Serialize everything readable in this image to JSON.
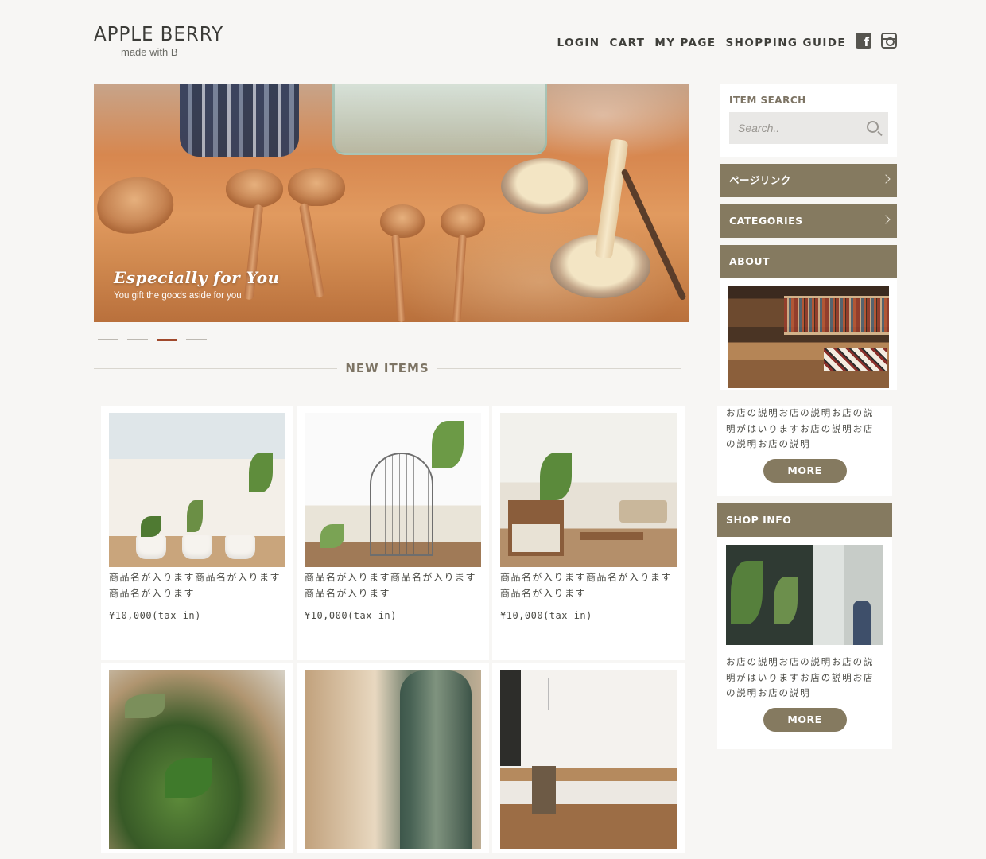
{
  "brand": {
    "name": "APPLE BERRY",
    "tagline": "made with B"
  },
  "nav": {
    "links": [
      "LOGIN",
      "CART",
      "MY PAGE",
      "SHOPPING GUIDE"
    ],
    "social": [
      "facebook-icon",
      "instagram-icon"
    ]
  },
  "hero": {
    "title": "Especially for You",
    "subtitle": "You gift the goods aside for you",
    "slides": 4,
    "active_slide": 3
  },
  "new_items": {
    "heading": "NEW ITEMS",
    "items": [
      {
        "name": "商品名が入ります商品名が入ります商品名が入ります",
        "price": "¥10,000(tax in)"
      },
      {
        "name": "商品名が入ります商品名が入ります商品名が入ります",
        "price": "¥10,000(tax in)"
      },
      {
        "name": "商品名が入ります商品名が入ります商品名が入ります",
        "price": "¥10,000(tax in)"
      },
      {
        "name": "",
        "price": ""
      },
      {
        "name": "",
        "price": ""
      },
      {
        "name": "",
        "price": ""
      }
    ]
  },
  "sidebar": {
    "search": {
      "heading": "ITEM SEARCH",
      "placeholder": "Search.."
    },
    "page_link": "ページリンク",
    "categories": "CATEGORIES",
    "about": {
      "heading": "ABOUT",
      "text": "お店の説明お店の説明お店の説明がはいりますお店の説明お店の説明お店の説明",
      "more": "MORE"
    },
    "shop_info": {
      "heading": "SHOP INFO",
      "text": "お店の説明お店の説明お店の説明がはいりますお店の説明お店の説明お店の説明",
      "more": "MORE"
    }
  },
  "colors": {
    "accent": "#857a60",
    "active_dot": "#a0492c",
    "background": "#f7f6f4"
  }
}
